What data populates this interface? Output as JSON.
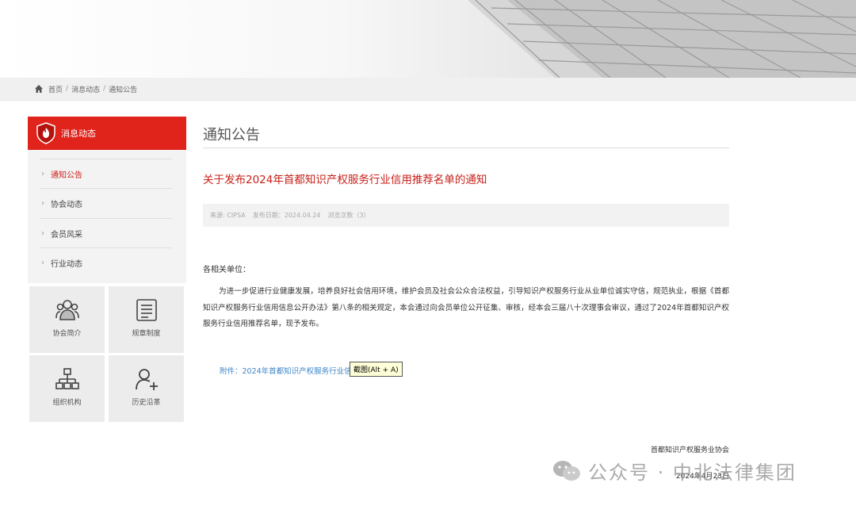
{
  "breadcrumb": {
    "home": "首页",
    "news": "消息动态",
    "current": "通知公告"
  },
  "sidebar": {
    "header": "消息动态",
    "items": [
      {
        "label": "通知公告",
        "active": true
      },
      {
        "label": "协会动态",
        "active": false
      },
      {
        "label": "会员风采",
        "active": false
      },
      {
        "label": "行业动态",
        "active": false
      }
    ],
    "tiles": [
      {
        "label": "协会简介",
        "icon": "people-group-icon"
      },
      {
        "label": "规章制度",
        "icon": "document-list-icon"
      },
      {
        "label": "组织机构",
        "icon": "org-chart-icon"
      },
      {
        "label": "历史沿革",
        "icon": "user-add-icon"
      }
    ]
  },
  "main": {
    "page_title": "通知公告",
    "article_title": "关于发布2024年首都知识产权服务行业信用推荐名单的通知",
    "meta": {
      "source": "来源: CIPSA",
      "date": "发布日期：2024.04.24",
      "views": "浏览次数（3）"
    },
    "salutation": "各相关单位：",
    "body": "为进一步促进行业健康发展，培养良好社会信用环境，维护会员及社会公众合法权益，引导知识产权服务行业从业单位诚实守信，规范执业，根据《首都知识产权服务行业信用信息公开办法》第八条的相关规定，本会通过向会员单位公开征集、审核，经本会三届八十次理事会审议，通过了2024年首都知识产权服务行业信用推荐名单，现予发布。",
    "attachment": "附件：2024年首都知识产权服务行业信用推荐名单",
    "tooltip": "截图(Alt + A)",
    "signature": "首都知识产权服务业协会",
    "sign_date": "2024年4月23日"
  },
  "watermark": {
    "text": "公众号 · 中北法律集团",
    "icon": "wechat-icon"
  },
  "colors": {
    "accent": "#e0241c",
    "link": "#3d84c6",
    "title_red": "#c8201a"
  }
}
